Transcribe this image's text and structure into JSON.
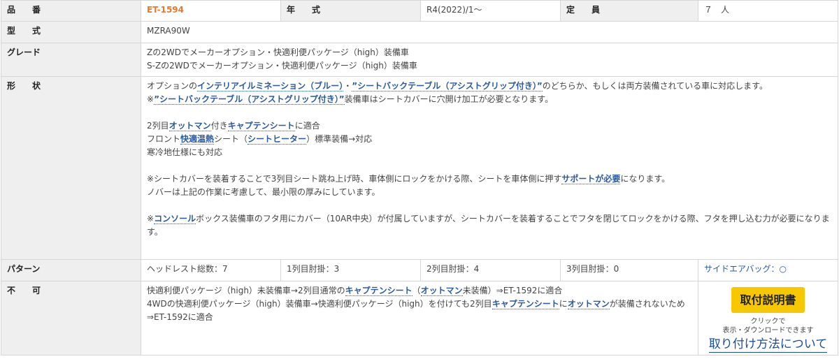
{
  "row1": {
    "label_part_no": "品　　番",
    "part_no": "ET-1594",
    "label_year": "年　　式",
    "year": "R4(2022)/1～",
    "label_capacity": "定　　員",
    "capacity": "７　人"
  },
  "row2": {
    "label": "型　　式",
    "value": "MZRA90W"
  },
  "row3": {
    "label": "グレード",
    "line1": "Zの2WDでメーカーオプション・快適利便パッケージ（high）装備車",
    "line2": "S-Zの2WDでメーカーオプション・快適利便パッケージ（high）装備車"
  },
  "row4": {
    "label": "形　　状",
    "p1_a": "オプションの",
    "p1_kw1": "インテリアイルミネーション（ブルー）",
    "p1_b": "・",
    "p1_kw2": "”シートバックテーブル（アシストグリップ付き）”",
    "p1_c": "のどちらか、もしくは両方装備されている車に対応します。",
    "p2_a": "※",
    "p2_kw": "”シートバックテーブル（アシストグリップ付き）”",
    "p2_b": "装備車はシートカバーに穴開け加工が必要となります。",
    "p3_a": "2列目",
    "p3_kw1": "オットマン",
    "p3_b": "付き",
    "p3_kw2": "キャプテンシート",
    "p3_c": "に適合",
    "p4_a": "フロント",
    "p4_kw1": "快適温熱",
    "p4_b": "シート（",
    "p4_kw2": "シートヒーター",
    "p4_c": "）標準装備→対応",
    "p5": "寒冷地仕様にも対応",
    "p6_a": "※シートカバーを装着することで3列目シート跳ね上げ時、車体側にロックをかける際、シートを車体側に押す",
    "p6_kw": "サポートが必要",
    "p6_b": "になります。",
    "p7": "ノバーは上記の作業に考慮して、最小限の厚みにしています。",
    "p8_a": "※",
    "p8_kw": "コンソール",
    "p8_b": "ボックス装備車のフタ用にカバー（10AR中央）が付属していますが、シートカバーを装着することでフタを閉じてロックをかける際、フタを押し込む力が必要になります。"
  },
  "row5": {
    "label": "パターン",
    "headrest": "ヘッドレスト総数：7",
    "row1_arm": "1列目肘掛：3",
    "row2_arm": "2列目肘掛：4",
    "row3_arm": "3列目肘掛：0",
    "side_airbag": "サイドエアバッグ：○"
  },
  "row6": {
    "label": "不　　可",
    "l1_a": "快適利便パッケージ（high）未装備車→2列目通常の",
    "l1_kw1": "キャプテンシート",
    "l1_b": "（",
    "l1_kw2": "オットマン",
    "l1_c": "未装備）⇒ET-1592に適合",
    "l2_a": "4WDの快適利便パッケージ（high）装備車→快適利便パッケージ（high）を付けても2列目",
    "l2_kw1": "キャプテンシート",
    "l2_b": "に",
    "l2_kw2": "オットマン",
    "l2_c": "が装備されないため⇒ET-1592に適合",
    "manual_button": "取付説明書",
    "note1": "クリックで",
    "note2": "表示・ダウンロードできます",
    "howto_link": "取り付け方法について"
  },
  "colors": {
    "label_bg": "#efefef",
    "code": "#e8782a",
    "keyword": "#2a5a9e",
    "button": "#f7c800"
  }
}
